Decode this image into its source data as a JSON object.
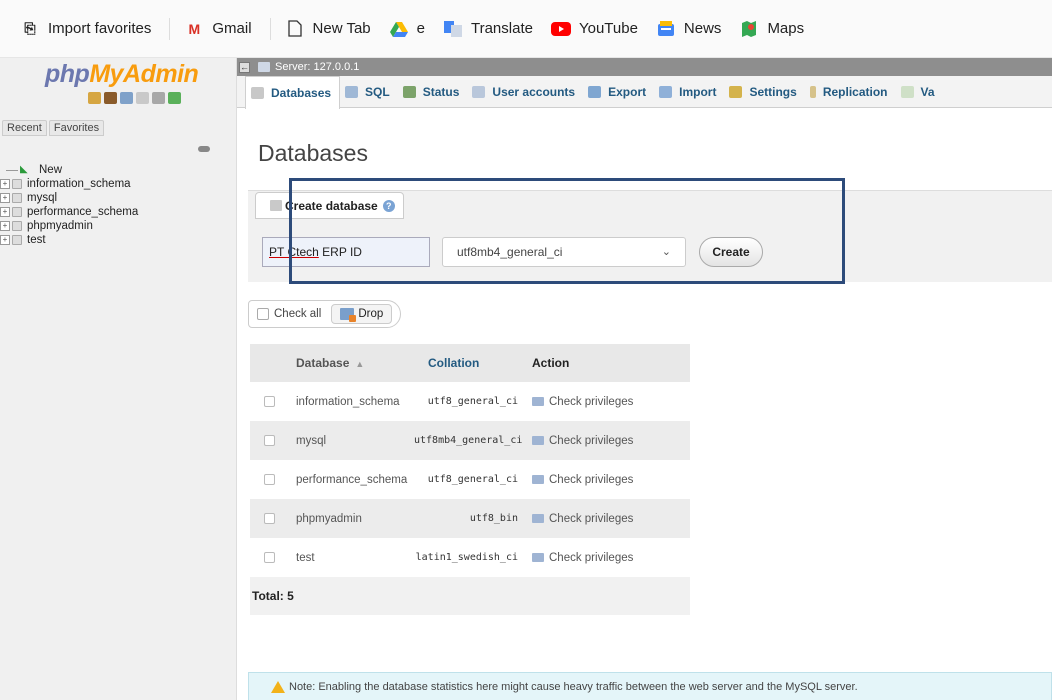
{
  "browser": {
    "favorites": [
      {
        "label": "Import favorites",
        "icon": "import-favorites-icon"
      },
      {
        "label": "Gmail",
        "icon": "gmail-icon"
      },
      {
        "label": "New Tab",
        "icon": "page-icon"
      },
      {
        "label": "e",
        "icon": "drive-icon"
      },
      {
        "label": "Translate",
        "icon": "translate-icon"
      },
      {
        "label": "YouTube",
        "icon": "youtube-icon"
      },
      {
        "label": "News",
        "icon": "news-icon"
      },
      {
        "label": "Maps",
        "icon": "maps-icon"
      }
    ]
  },
  "sidebar": {
    "logo_php": "php",
    "logo_myadmin": "MyAdmin",
    "tabs": [
      "Recent",
      "Favorites"
    ],
    "new_label": "New",
    "databases": [
      "information_schema",
      "mysql",
      "performance_schema",
      "phpmyadmin",
      "test"
    ]
  },
  "server": {
    "label": "Server: 127.0.0.1"
  },
  "top_tabs": [
    "Databases",
    "SQL",
    "Status",
    "User accounts",
    "Export",
    "Import",
    "Settings",
    "Replication",
    "Va"
  ],
  "page": {
    "title": "Databases"
  },
  "create": {
    "legend": "Create database",
    "name_value_underlined": "PT Ctech",
    "name_value_rest": " ERP ID",
    "collation_value": "utf8mb4_general_ci",
    "button": "Create"
  },
  "bulk": {
    "check_all": "Check all",
    "drop": "Drop"
  },
  "table": {
    "headers": {
      "database": "Database",
      "collation": "Collation",
      "action": "Action"
    },
    "rows": [
      {
        "database": "information_schema",
        "collation": "utf8_general_ci",
        "action": "Check privileges"
      },
      {
        "database": "mysql",
        "collation": "utf8mb4_general_ci",
        "action": "Check privileges"
      },
      {
        "database": "performance_schema",
        "collation": "utf8_general_ci",
        "action": "Check privileges"
      },
      {
        "database": "phpmyadmin",
        "collation": "utf8_bin",
        "action": "Check privileges"
      },
      {
        "database": "test",
        "collation": "latin1_swedish_ci",
        "action": "Check privileges"
      }
    ],
    "total": "Total: 5"
  },
  "note": "Note: Enabling the database statistics here might cause heavy traffic between the web server and the MySQL server.",
  "colors": {
    "link": "#235a81",
    "highlight_border": "#2d4b7a",
    "logo_blue": "#6c78af",
    "logo_orange": "#f89c0e"
  }
}
